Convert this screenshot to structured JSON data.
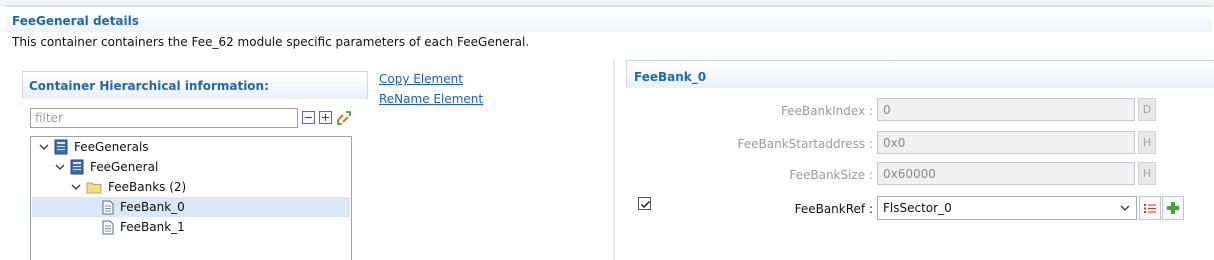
{
  "page": {
    "title": "FeeGeneral details",
    "description": "This container containers the Fee_62 module specific parameters of each FeeGeneral."
  },
  "hierarchy": {
    "title": "Container Hierarchical information:",
    "filter_placeholder": "filter",
    "tree": [
      {
        "label": "FeeGenerals",
        "icon": "container-icon",
        "expanded": true
      },
      {
        "label": "FeeGeneral",
        "icon": "container-icon",
        "expanded": true
      },
      {
        "label": "FeeBanks (2)",
        "icon": "folder-icon",
        "expanded": true
      },
      {
        "label": "FeeBank_0",
        "icon": "document-icon",
        "selected": true
      },
      {
        "label": "FeeBank_1",
        "icon": "document-icon"
      }
    ]
  },
  "actions": {
    "copy": "Copy Element",
    "rename": "ReName Element"
  },
  "details": {
    "title": "FeeBank_0",
    "fields": [
      {
        "label": "FeeBankIndex :",
        "value": "0",
        "suffix": "D"
      },
      {
        "label": "FeeBankStartaddress :",
        "value": "0x0",
        "suffix": "H"
      },
      {
        "label": "FeeBankSize :",
        "value": "0x60000",
        "suffix": "H"
      }
    ],
    "ref": {
      "label": "FeeBankRef :",
      "value": "FlsSector_0",
      "enabled": true
    }
  },
  "colors": {
    "accent": "#1e6aa8",
    "link": "#1a5fb4",
    "selection": "#d9e8f8"
  }
}
